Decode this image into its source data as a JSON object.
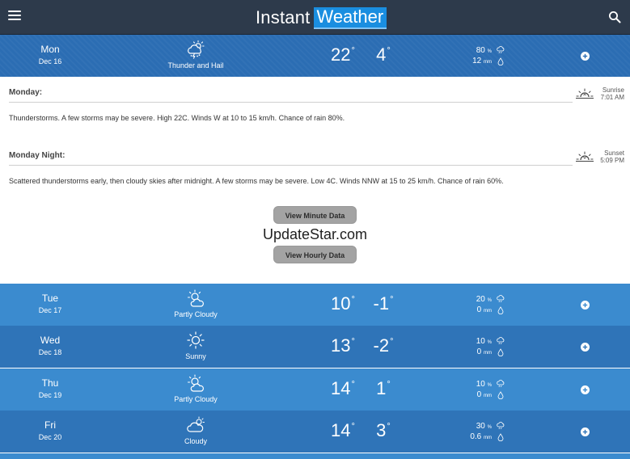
{
  "header": {
    "logo_part1": "Instant",
    "logo_part2": "Weather",
    "menu_icon": "hamburger-menu-icon",
    "search_icon": "search-icon"
  },
  "days": [
    {
      "day": "Mon",
      "date": "Dec 16",
      "condition": "Thunder and Hail",
      "icon": "thunder-hail-icon",
      "high": "22",
      "low": "4",
      "precip_chance": "80",
      "precip_amount": "12",
      "chance_unit": "%",
      "amount_unit": "mm"
    },
    {
      "day": "Tue",
      "date": "Dec 17",
      "condition": "Partly Cloudy",
      "icon": "partly-cloudy-icon",
      "high": "10",
      "low": "-1",
      "precip_chance": "20",
      "precip_amount": "0",
      "chance_unit": "%",
      "amount_unit": "mm"
    },
    {
      "day": "Wed",
      "date": "Dec 18",
      "condition": "Sunny",
      "icon": "sunny-icon",
      "high": "13",
      "low": "-2",
      "precip_chance": "10",
      "precip_amount": "0",
      "chance_unit": "%",
      "amount_unit": "mm"
    },
    {
      "day": "Thu",
      "date": "Dec 19",
      "condition": "Partly Cloudy",
      "icon": "partly-cloudy-icon",
      "high": "14",
      "low": "1",
      "precip_chance": "10",
      "precip_amount": "0",
      "chance_unit": "%",
      "amount_unit": "mm"
    },
    {
      "day": "Fri",
      "date": "Dec 20",
      "condition": "Cloudy",
      "icon": "cloudy-icon",
      "high": "14",
      "low": "3",
      "precip_chance": "30",
      "precip_amount": "0.6",
      "chance_unit": "%",
      "amount_unit": "mm"
    }
  ],
  "detail": {
    "day_title": "Monday:",
    "day_text": "Thunderstorms. A few storms may be severe. High 22C. Winds W at 10 to 15 km/h. Chance of rain 80%.",
    "sunrise_label": "Sunrise",
    "sunrise_time": "7:01 AM",
    "night_title": "Monday Night:",
    "night_text": "Scattered thunderstorms early, then cloudy skies after midnight. A few storms may be severe. Low 4C. Winds NNW at 15 to 25 km/h. Chance of rain 60%.",
    "sunset_label": "Sunset",
    "sunset_time": "5:09 PM",
    "minute_button": "View Minute Data",
    "hourly_button": "View Hourly Data"
  },
  "watermark": "UpdateStar.com",
  "colors": {
    "topbar": "#2d3a4b",
    "active_row": "#2b6db3",
    "row_light": "#3b8bcf",
    "row_dark": "#2f74b8",
    "logo_accent": "#1a8ee0",
    "button_gray": "#a3a3a3"
  }
}
